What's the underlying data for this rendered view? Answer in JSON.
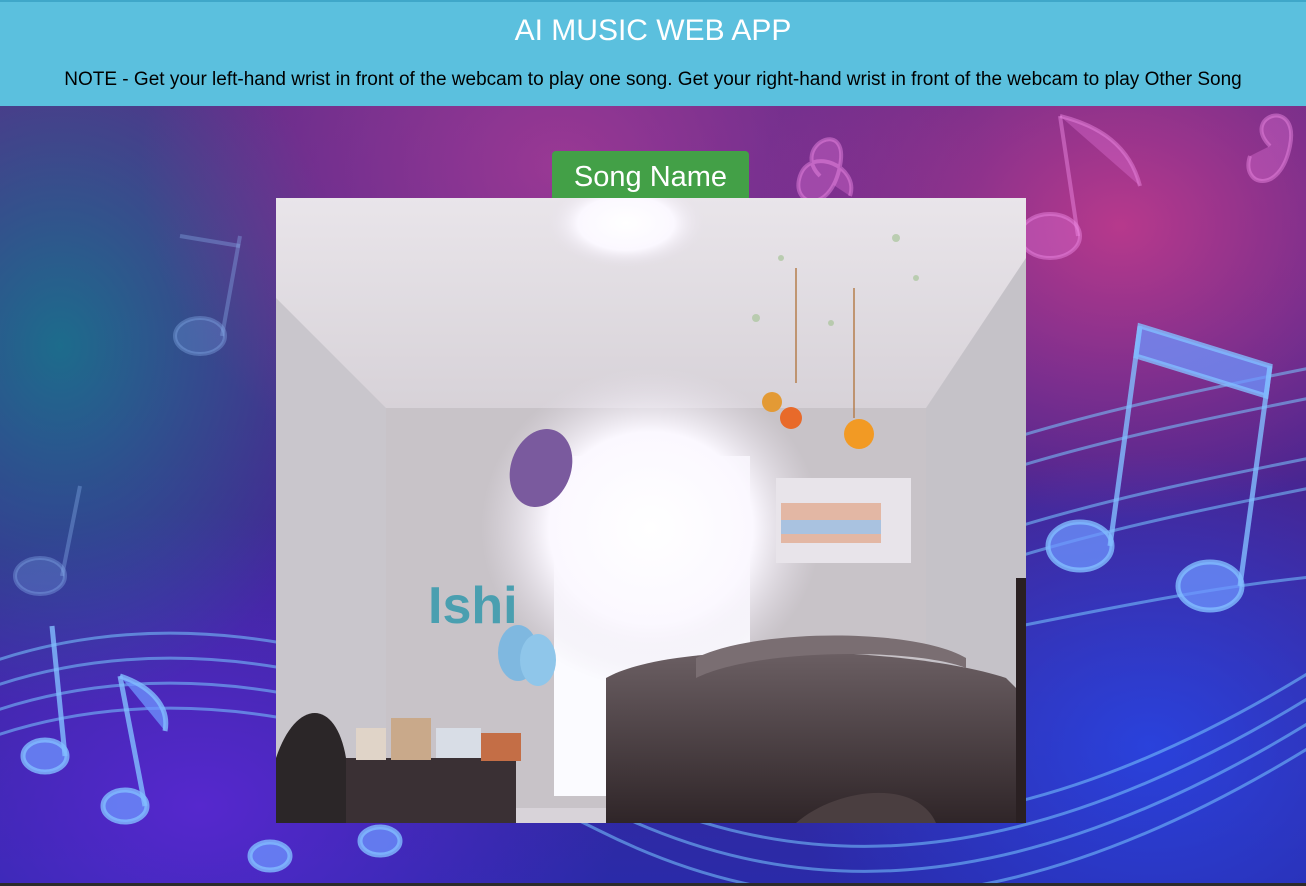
{
  "header": {
    "title": "AI MUSIC WEB APP",
    "note": "NOTE - Get your left-hand wrist in front of the webcam to play one song. Get your right-hand wrist in front of the webcam to play Other Song"
  },
  "song_button": {
    "label": "Song Name"
  },
  "webcam": {
    "wall_text": "Ishi"
  },
  "colors": {
    "header_bg": "#5bc0de",
    "button_bg": "#43a047",
    "title_color": "#ffffff"
  },
  "icons": [
    "music-notes-background"
  ]
}
